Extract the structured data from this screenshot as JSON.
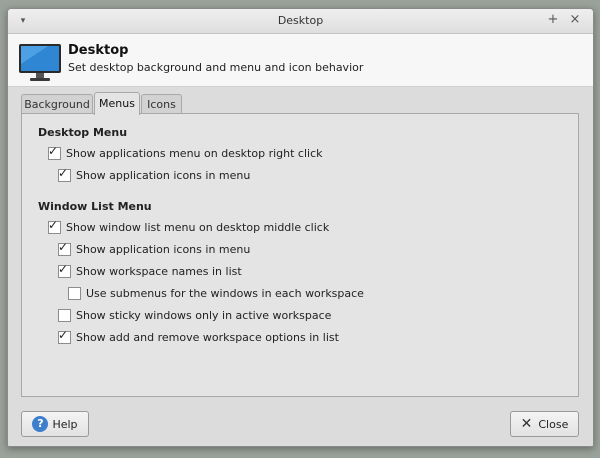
{
  "window": {
    "title": "Desktop",
    "menu_glyph": "▾",
    "maximize_glyph": "+",
    "close_glyph": "×"
  },
  "header": {
    "title": "Desktop",
    "subtitle": "Set desktop background and menu and icon behavior",
    "icon": "monitor-icon"
  },
  "tabs": [
    {
      "label": "Background",
      "active": false
    },
    {
      "label": "Menus",
      "active": true
    },
    {
      "label": "Icons",
      "active": false
    }
  ],
  "desktop_menu": {
    "title": "Desktop Menu",
    "options": [
      {
        "label": "Show applications menu on desktop right click",
        "checked": true
      },
      {
        "label": "Show application icons in menu",
        "checked": true
      }
    ]
  },
  "window_list_menu": {
    "title": "Window List Menu",
    "options": [
      {
        "label": "Show window list menu on desktop middle click",
        "checked": true
      },
      {
        "label": "Show application icons in menu",
        "checked": true
      },
      {
        "label": "Show workspace names in list",
        "checked": true
      },
      {
        "label": "Use submenus for the windows in each workspace",
        "checked": false
      },
      {
        "label": "Show sticky windows only in active workspace",
        "checked": false
      },
      {
        "label": "Show add and remove workspace options in list",
        "checked": true
      }
    ]
  },
  "footer": {
    "help_label": "Help",
    "close_label": "Close"
  },
  "colors": {
    "accent": "#3d7fcc",
    "monitor_screen": "#2f86d3"
  }
}
